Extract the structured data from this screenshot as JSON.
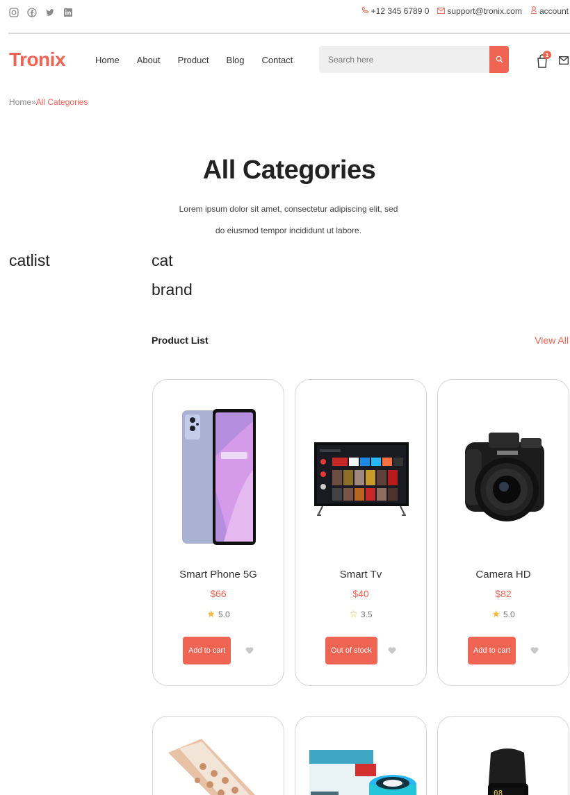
{
  "topbar": {
    "social": [
      "instagram-icon",
      "facebook-icon",
      "twitter-icon",
      "linkedin-icon"
    ],
    "phone": "+12 345 6789 0",
    "email": "support@tronix.com",
    "account": "account"
  },
  "header": {
    "logo": "Tronix",
    "nav": [
      "Home",
      "About",
      "Product",
      "Blog",
      "Contact"
    ],
    "search_placeholder": "Search here",
    "cart_count": "1"
  },
  "breadcrumb": {
    "home": "Home",
    "separator": "»",
    "current": "All Categories"
  },
  "main": {
    "title": "All Categories",
    "subtitle": "Lorem ipsum dolor sit amet, consectetur adipiscing elit, sed do eiusmod tempor incididunt ut labore.",
    "catlist": "catlist",
    "cat": "cat",
    "brand": "brand",
    "product_list_title": "Product List",
    "view_all": "View All"
  },
  "products": [
    {
      "name": "Smart Phone 5G",
      "price": "$66",
      "rating": "5.0",
      "button": "Add to cart"
    },
    {
      "name": "Smart Tv",
      "price": "$40",
      "rating": "3.5",
      "button": "Out of stock"
    },
    {
      "name": "Camera HD",
      "price": "$82",
      "rating": "5.0",
      "button": "Add to cart"
    }
  ],
  "colors": {
    "accent": "#f06454",
    "star": "#f5b83d",
    "text": "#333333"
  }
}
